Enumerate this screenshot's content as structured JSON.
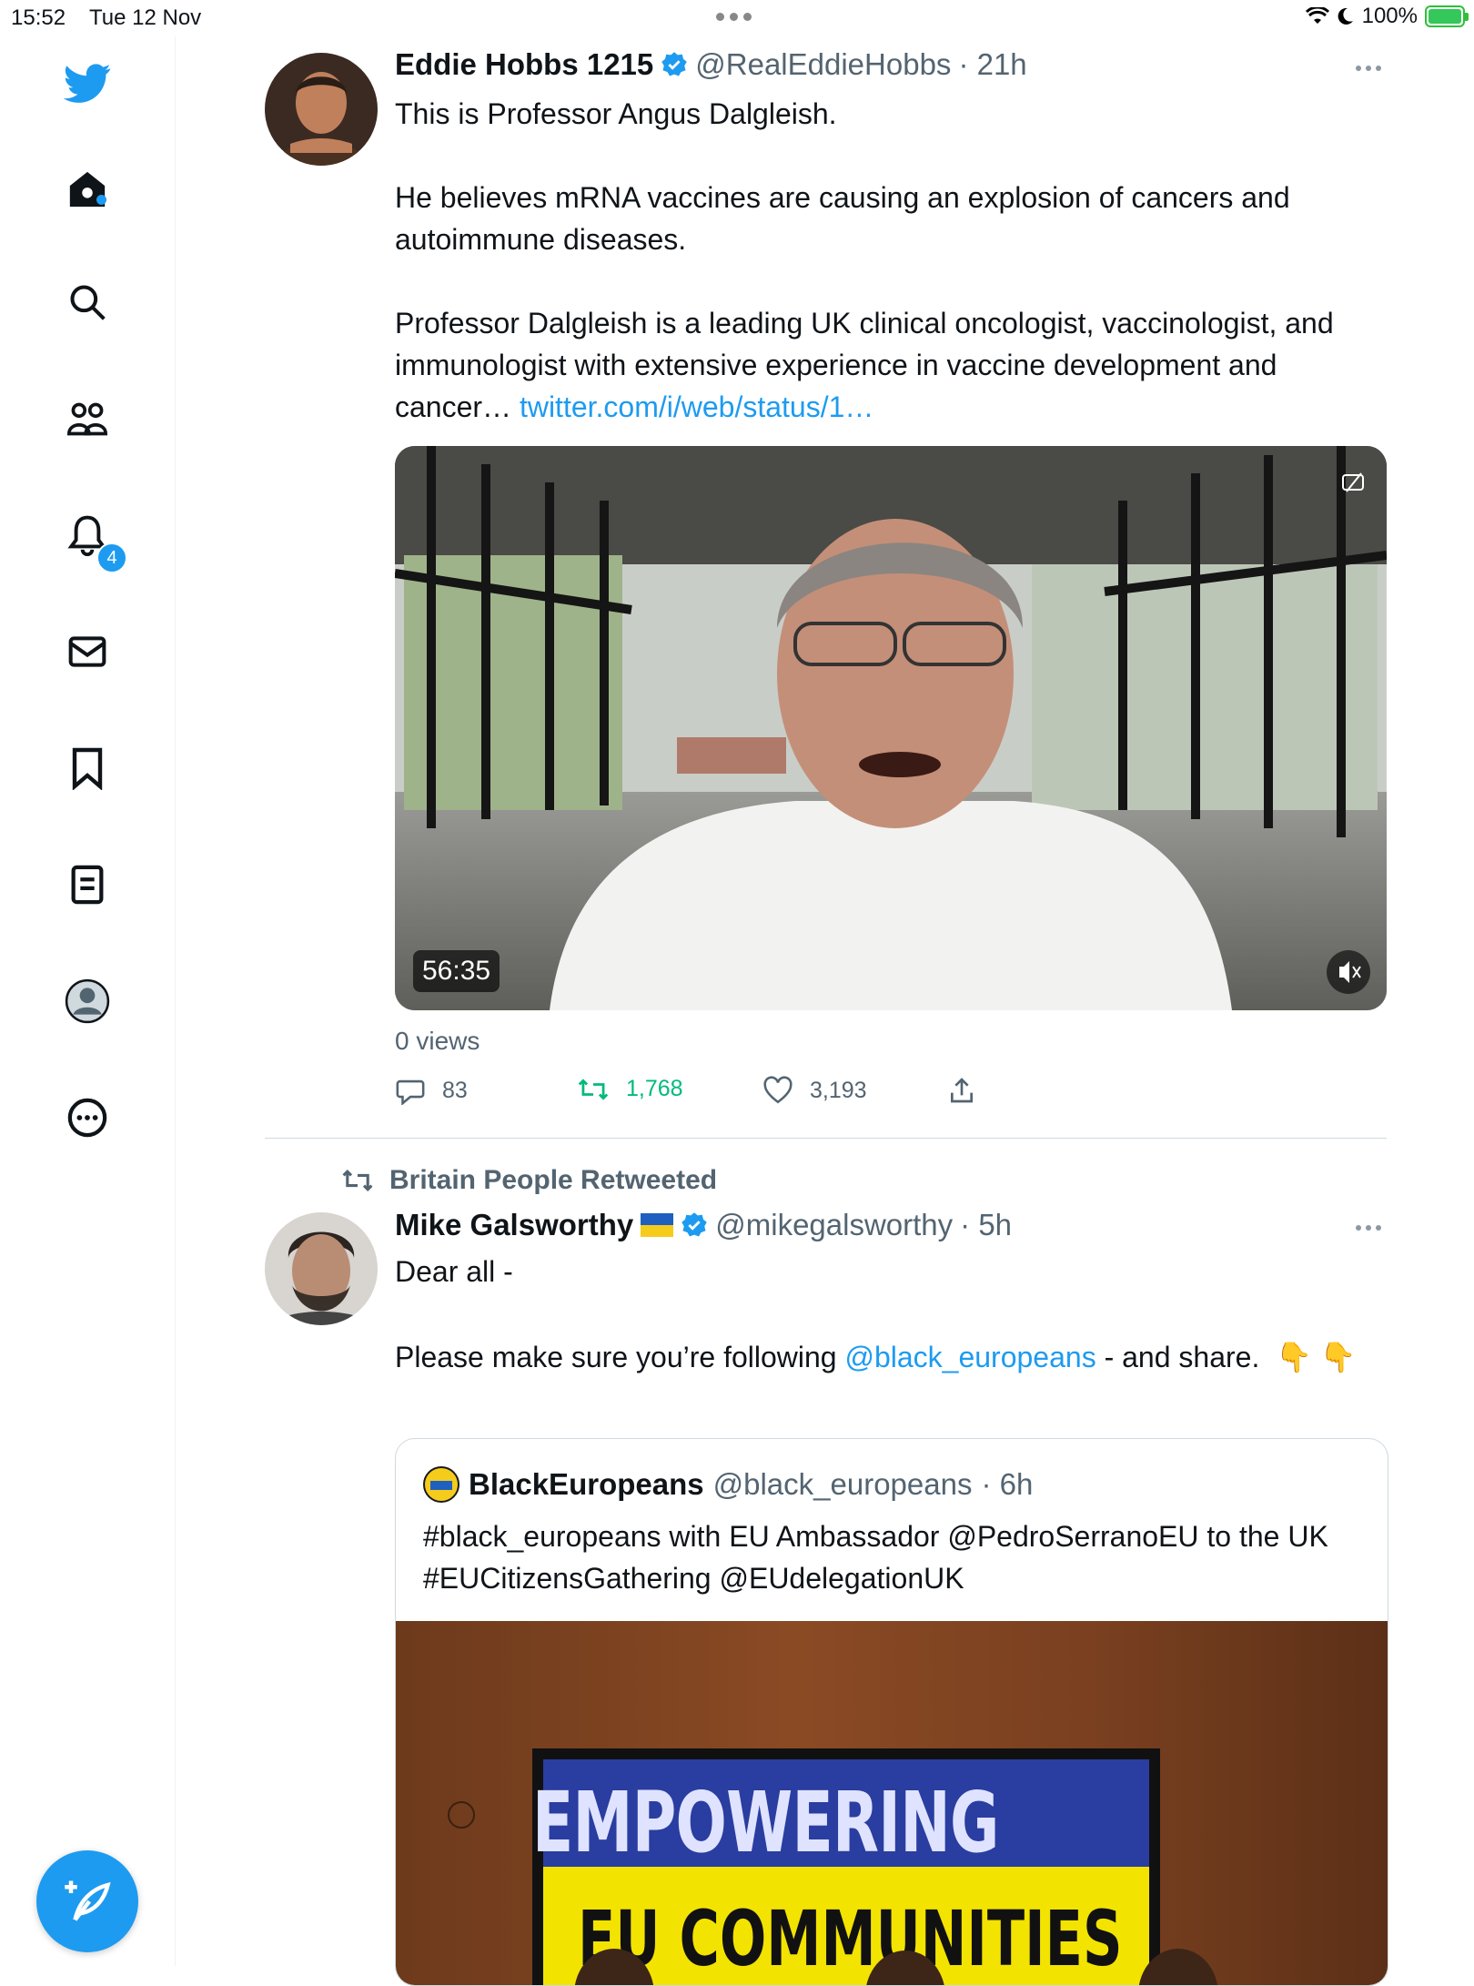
{
  "status_bar": {
    "time": "15:52",
    "date": "Tue 12 Nov",
    "battery": "100%"
  },
  "sidebar": {
    "items": [
      {
        "name": "twitter-logo-icon"
      },
      {
        "name": "home-icon"
      },
      {
        "name": "search-icon"
      },
      {
        "name": "communities-icon"
      },
      {
        "name": "notifications-icon"
      },
      {
        "name": "messages-icon"
      },
      {
        "name": "bookmarks-icon"
      },
      {
        "name": "lists-icon"
      },
      {
        "name": "profile-icon"
      },
      {
        "name": "more-icon"
      }
    ],
    "notification_count": "4"
  },
  "tweet1": {
    "name": "Eddie Hobbs 1215",
    "handle": "@RealEddieHobbs",
    "time": "· 21h",
    "text_1": "This is Professor Angus Dalgleish.",
    "text_2": "He believes mRNA vaccines are causing an explosion of cancers and autoimmune diseases.",
    "text_3": "Professor Dalgleish is a leading UK clinical oncologist, vaccinologist, and immunologist with extensive experience in vaccine development and cancer… ",
    "link": "twitter.com/i/web/status/1…",
    "video_duration": "56:35",
    "views": "0 views",
    "replies": "83",
    "retweets": "1,768",
    "likes": "3,193"
  },
  "tweet2": {
    "retweeted_by": "Britain People Retweeted",
    "name": "Mike Galsworthy",
    "handle": "@mikegalsworthy",
    "time": "· 5h",
    "text_1": "Dear all -",
    "text_2a": "Please make sure you’re following ",
    "mention": "@black_europeans",
    "text_2b": " - and share.  👇 👇",
    "quote": {
      "name": "BlackEuropeans",
      "handle": "@black_europeans",
      "time": "· 6h",
      "text": "#black_europeans with EU Ambassador @PedroSerranoEU to the UK #EUCitizensGathering @EUdelegationUK",
      "sign_line_1": "EMPOWERING",
      "sign_line_2": "EU COMMUNITIES"
    }
  },
  "colors": {
    "accent": "#1d9bf0",
    "retweet": "#00ba7c",
    "secondary": "#536471"
  }
}
